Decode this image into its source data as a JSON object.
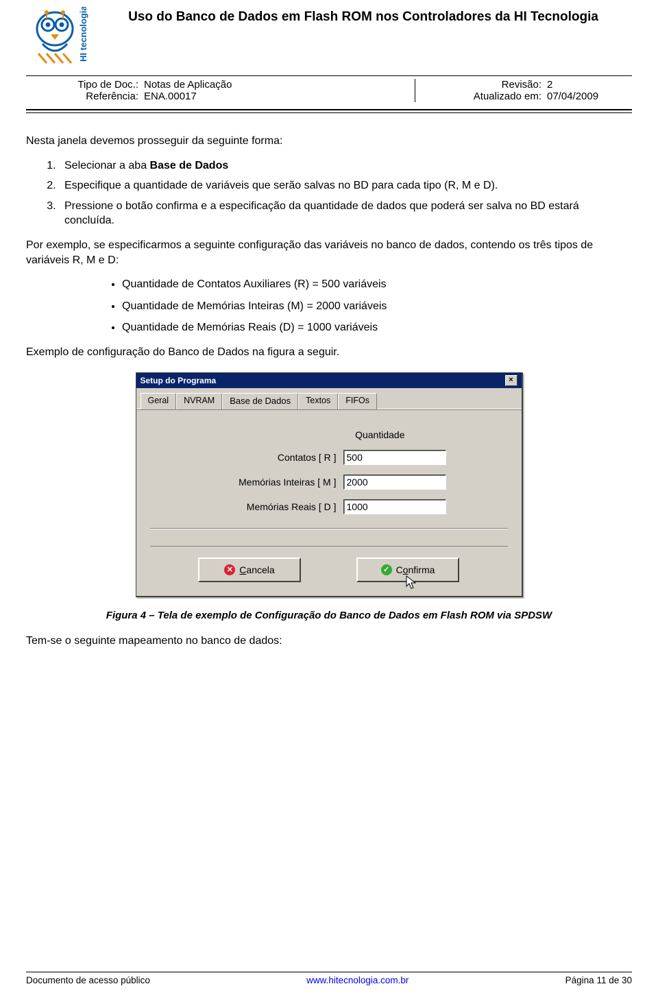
{
  "header": {
    "title": "Uso do Banco de Dados em Flash ROM nos Controladores da HI Tecnologia",
    "tipo_doc_label": "Tipo de Doc.:",
    "tipo_doc_value": "Notas de Aplicação",
    "referencia_label": "Referência:",
    "referencia_value": "ENA.00017",
    "revisao_label": "Revisão:",
    "revisao_value": "2",
    "atualizado_label": "Atualizado em:",
    "atualizado_value": "07/04/2009"
  },
  "body": {
    "intro_line": "Nesta janela devemos prosseguir da seguinte forma:",
    "step1_pre": "Selecionar a aba ",
    "step1_bold": "Base de Dados",
    "step2": "Especifique a quantidade de variáveis que serão salvas no BD para cada tipo (R, M e D).",
    "step3": "Pressione o botão confirma e a especificação da quantidade de dados que poderá ser salva no BD estará concluída.",
    "example_intro": "Por exemplo, se especificarmos a seguinte configuração das variáveis no banco de dados, contendo os três tipos de variáveis R, M e D:",
    "bullets": [
      "Quantidade de Contatos Auxiliares (R) = 500 variáveis",
      "Quantidade de Memórias Inteiras (M) = 2000 variáveis",
      "Quantidade de Memórias Reais (D) = 1000 variáveis"
    ],
    "example_outro": "Exemplo de configuração do Banco de Dados na figura a seguir.",
    "figure_caption": "Figura 4 – Tela de exemplo de Configuração do Banco de Dados em Flash ROM via SPDSW",
    "closing_line": "Tem-se o seguinte mapeamento no banco de dados:"
  },
  "dialog": {
    "title": "Setup do Programa",
    "close_glyph": "×",
    "tabs": {
      "geral": "Geral",
      "nvram": "NVRAM",
      "base": "Base de Dados",
      "textos": "Textos",
      "fifos": "FIFOs"
    },
    "qty_header": "Quantidade",
    "rows": {
      "contatos_label": "Contatos [ R ]",
      "contatos_value": "500",
      "inteiras_label": "Memórias Inteiras [ M ]",
      "inteiras_value": "2000",
      "reais_label": "Memórias Reais [ D ]",
      "reais_value": "1000"
    },
    "buttons": {
      "cancela": "Cancela",
      "confirma": "Confirma"
    }
  },
  "footer": {
    "left": "Documento de acesso público",
    "center": "www.hitecnologia.com.br",
    "right": "Página 11 de 30"
  }
}
